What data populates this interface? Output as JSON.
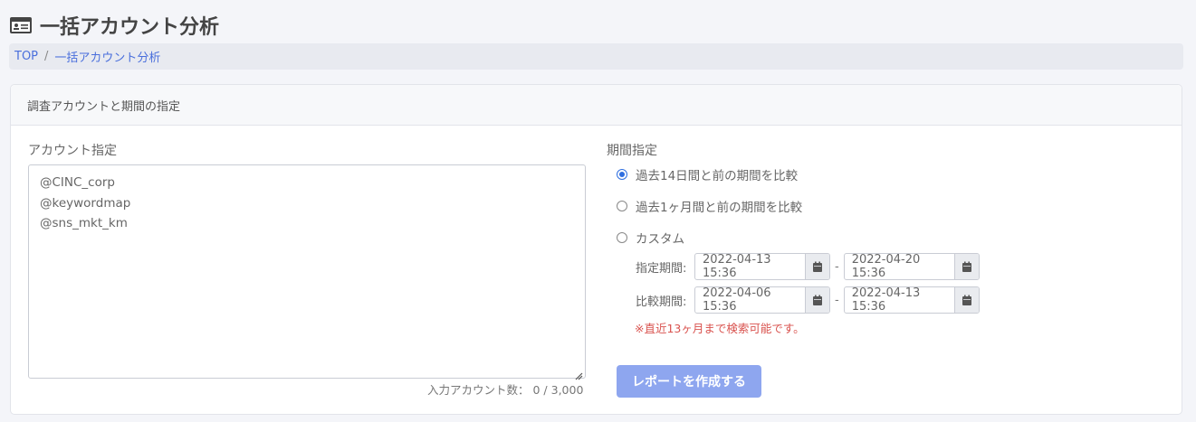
{
  "page": {
    "title": "一括アカウント分析",
    "title_icon": "id-card-icon"
  },
  "breadcrumb": {
    "items": [
      "TOP",
      "一括アカウント分析"
    ],
    "separator": "/"
  },
  "card": {
    "header": "調査アカウントと期間の指定",
    "accounts": {
      "label": "アカウント指定",
      "lines": [
        "@CINC_corp",
        "@keywordmap",
        "@sns_mkt_km"
      ],
      "count_label": "入力アカウント数：",
      "count_value": "0 / 3,000"
    },
    "period": {
      "label": "期間指定",
      "options": [
        {
          "label": "過去14日間と前の期間を比較",
          "checked": true
        },
        {
          "label": "過去1ヶ月間と前の期間を比較",
          "checked": false
        },
        {
          "label": "カスタム",
          "checked": false
        }
      ],
      "target": {
        "label": "指定期間:",
        "start": "2022-04-13 15:36",
        "end": "2022-04-20 15:36"
      },
      "compare": {
        "label": "比較期間:",
        "start": "2022-04-06 15:36",
        "end": "2022-04-13 15:36"
      },
      "range_dash": "-",
      "note": "※直近13ヶ月まで検索可能です。"
    },
    "submit_label": "レポートを作成する"
  },
  "colors": {
    "accent": "#2f6fe0",
    "link": "#4a6fdc",
    "button": "#8ea6ef",
    "warning": "#d9534f"
  }
}
